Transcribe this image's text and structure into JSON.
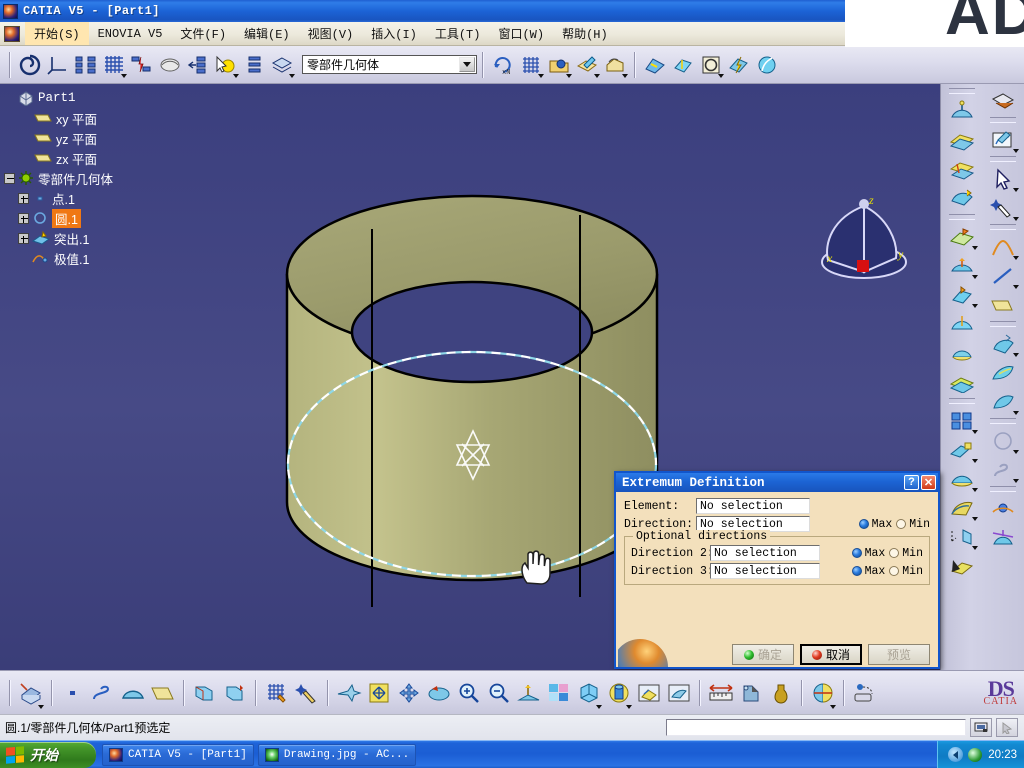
{
  "window": {
    "title": "CATIA V5 - [Part1]",
    "icon": "catia-icon"
  },
  "menubar": {
    "icon": "catia-small-icon",
    "items": [
      {
        "label": "开始(S)",
        "highlighted": true
      },
      {
        "label": "ENOVIA V5",
        "highlighted": false
      },
      {
        "label": "文件(F)",
        "highlighted": false
      },
      {
        "label": "编辑(E)",
        "highlighted": false
      },
      {
        "label": "视图(V)",
        "highlighted": false
      },
      {
        "label": "插入(I)",
        "highlighted": false
      },
      {
        "label": "工具(T)",
        "highlighted": false
      },
      {
        "label": "窗口(W)",
        "highlighted": false
      },
      {
        "label": "帮助(H)",
        "highlighted": false
      }
    ]
  },
  "toolbar_top": {
    "combo_value": "零部件几何体",
    "icons": [
      "swirl-icon",
      "axis-system-icon",
      "tree-structure-icon",
      "grid-icon",
      "tree-flash-icon",
      "wireframe-sketch-icon",
      "tree-indent-icon",
      "highlight-arrow-icon",
      "list-lines-icon",
      "layers-icon"
    ],
    "icons_right": [
      "repeat-object-icon",
      "grid-pattern-icon",
      "load-part-icon",
      "sketch-edit-icon",
      "house-measure-icon",
      "surface-fill-icon",
      "extrude-icon",
      "circle-frame-icon",
      "lightning-surface-icon",
      "blend-icon"
    ]
  },
  "tree": {
    "root": "Part1",
    "nodes": [
      {
        "label": "xy 平面",
        "icon": "plane-icon",
        "expandable": false,
        "selected": false,
        "depth": 1
      },
      {
        "label": "yz 平面",
        "icon": "plane-icon",
        "expandable": false,
        "selected": false,
        "depth": 1
      },
      {
        "label": "zx 平面",
        "icon": "plane-icon",
        "expandable": false,
        "selected": false,
        "depth": 1
      },
      {
        "label": "零部件几何体",
        "icon": "body-icon",
        "expandable": true,
        "expanded": true,
        "selected": false,
        "depth": 1
      },
      {
        "label": "点.1",
        "icon": "point-icon",
        "expandable": true,
        "selected": false,
        "depth": 2
      },
      {
        "label": "圆.1",
        "icon": "circle-icon",
        "expandable": true,
        "selected": true,
        "depth": 2
      },
      {
        "label": "突出.1",
        "icon": "extrude-small-icon",
        "expandable": true,
        "selected": false,
        "depth": 2
      },
      {
        "label": "极值.1",
        "icon": "extremum-icon",
        "expandable": false,
        "selected": false,
        "depth": 2
      }
    ]
  },
  "viewport": {
    "compass_labels": {
      "x": "x",
      "y": "y",
      "z": "z"
    },
    "background_color": "#3b3f7e",
    "part_color": "#a3a472",
    "highlight_curve_color": "#8fd8e8"
  },
  "dialog": {
    "title": "Extremum Definition",
    "help_label": "?",
    "close_label": "✕",
    "fields": [
      {
        "label": "Element:",
        "value": "No selection",
        "has_radios": false
      },
      {
        "label": "Direction:",
        "value": "No selection",
        "has_radios": true,
        "max_label": "Max",
        "min_label": "Min",
        "selected": "Max"
      }
    ],
    "group": {
      "legend": "Optional directions",
      "fields": [
        {
          "label": "Direction 2:",
          "value": "No selection",
          "max_label": "Max",
          "min_label": "Min",
          "selected": "Max"
        },
        {
          "label": "Direction 3:",
          "value": "No selection",
          "max_label": "Max",
          "min_label": "Min",
          "selected": "Max"
        }
      ]
    },
    "buttons": [
      {
        "label": "确定",
        "state": "disabled",
        "led": "green"
      },
      {
        "label": "取消",
        "state": "focused",
        "led": "red"
      },
      {
        "label": "预览",
        "state": "disabled",
        "led": "none"
      }
    ]
  },
  "toolbar_bottom": {
    "icons": [
      "isometric-view-icon",
      "point-icon",
      "spline-icon",
      "arc-icon",
      "plane-icon",
      "extrude-surface-icon",
      "revolve-surface-icon",
      "grid-sketch-icon",
      "magic-wand-icon",
      "fly-mode-icon",
      "fit-all-icon",
      "pan-icon",
      "rotate-icon",
      "zoom-in-icon",
      "zoom-out-icon",
      "normal-view-icon",
      "multi-view-icon",
      "shading-icon",
      "material-cylinder-icon",
      "hide-show-icon",
      "swap-visible-icon",
      "measure-icon",
      "measure-item-icon",
      "inertia-icon",
      "section-icon",
      "render-icon"
    ],
    "logo": {
      "line1": "DS",
      "line2": "CATIA"
    }
  },
  "statusbar": {
    "message": "圆.1/零部件几何体/Part1预选定",
    "input_value": "",
    "buttons": [
      "power-input-icon",
      "pointer-icon"
    ]
  },
  "taskbar": {
    "start_label": "开始",
    "items": [
      {
        "label": "CATIA V5 - [Part1]",
        "icon": "catia-icon",
        "active": true
      },
      {
        "label": "Drawing.jpg - AC...",
        "icon": "acdsee-icon",
        "active": false
      }
    ],
    "tray": {
      "time": "20:23",
      "chevron": "show-hidden-icons",
      "volume": "volume-icon"
    }
  },
  "overlay": {
    "watermark_text": "AD"
  }
}
